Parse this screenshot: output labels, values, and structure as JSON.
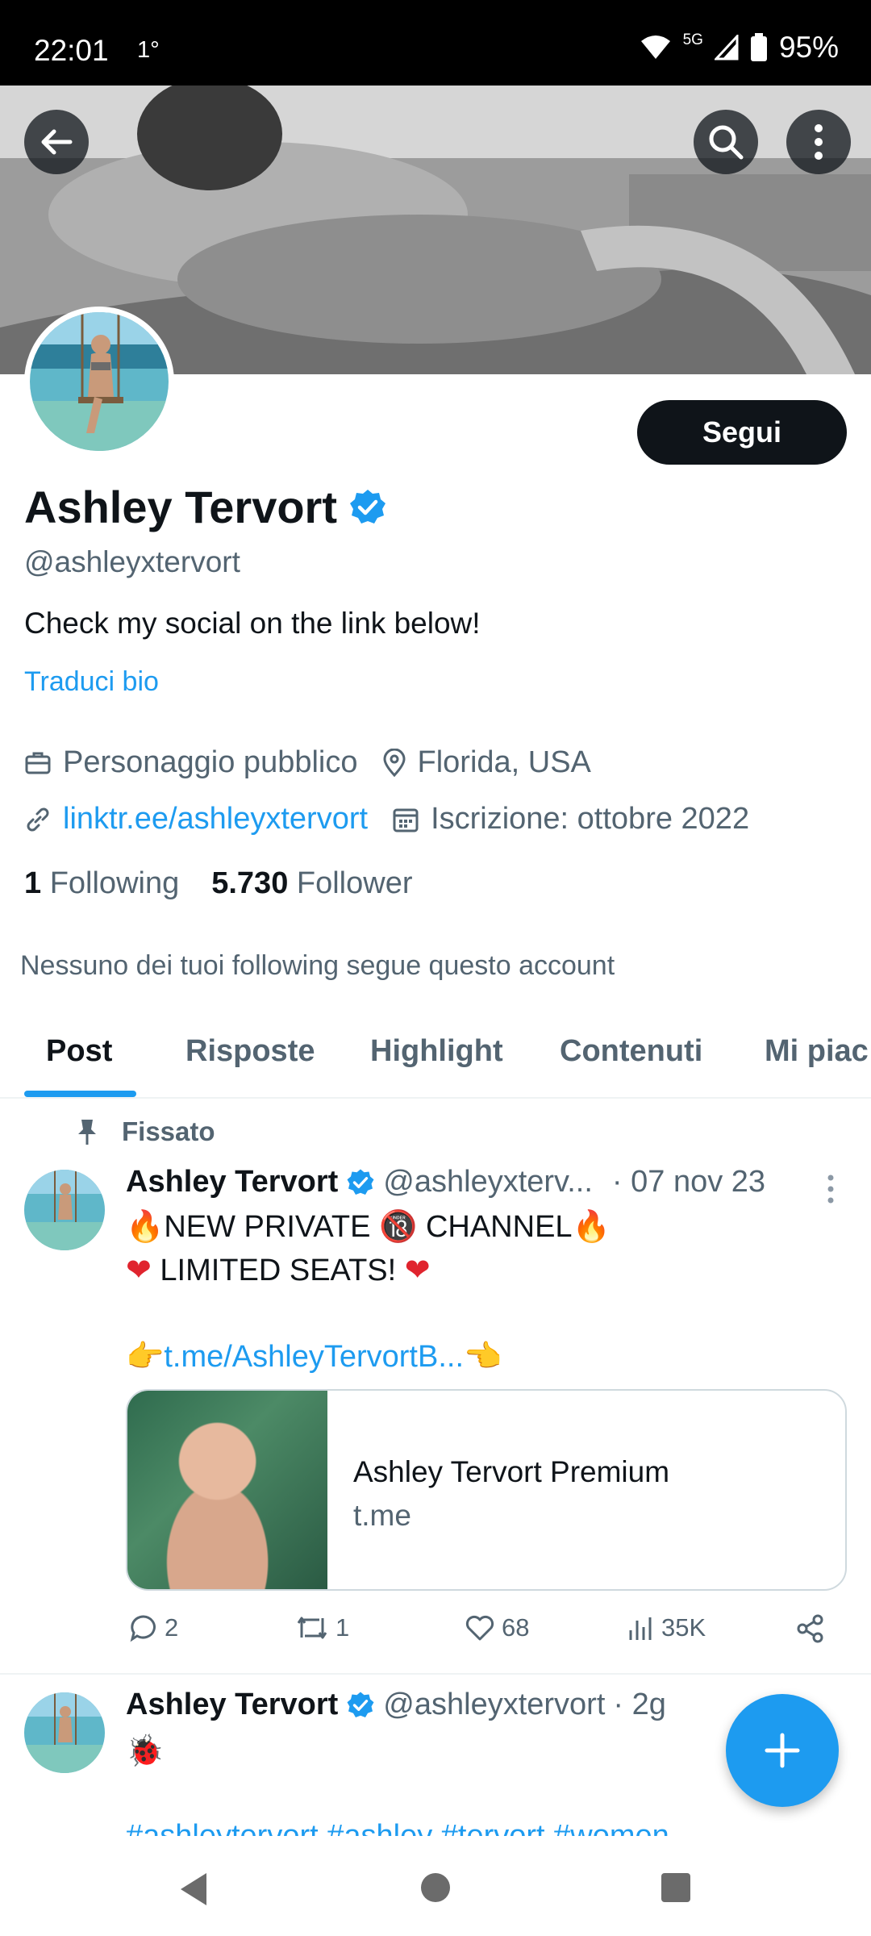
{
  "status_bar": {
    "time": "22:01",
    "temperature": "1°",
    "network": "5G",
    "battery": "95%"
  },
  "header": {
    "back_icon": "arrow-left-icon",
    "search_icon": "search-icon",
    "more_icon": "more-vertical-icon"
  },
  "profile": {
    "name": "Ashley Tervort",
    "handle": "@ashleyxtervort",
    "bio": "Check my social on the link below!",
    "translate_label": "Traduci bio",
    "follow_label": "Segui",
    "category": "Personaggio pubblico",
    "location": "Florida, USA",
    "website": "linktr.ee/ashleyxtervort",
    "joined": "Iscrizione: ottobre 2022",
    "following_count": "1",
    "following_label": "Following",
    "followers_count": "5.730",
    "followers_label": "Follower",
    "mutuals_note": "Nessuno dei tuoi following segue questo account"
  },
  "tabs": [
    "Post",
    "Risposte",
    "Highlight",
    "Contenuti",
    "Mi piac"
  ],
  "posts": [
    {
      "pinned_label": "Fissato",
      "name": "Ashley Tervort",
      "handle": "@ashleyxterv...",
      "time": "· 07 nov 23",
      "line1_a": "NEW PRIVATE",
      "line1_b": "CHANNEL",
      "line2": "LIMITED SEATS!",
      "link": "t.me/AshleyTervortB...",
      "card_title": "Ashley Tervort Premium",
      "card_domain": "t.me",
      "replies": "2",
      "reposts": "1",
      "likes": "68",
      "views": "35K"
    },
    {
      "name": "Ashley Tervort",
      "handle": "@ashleyxtervort",
      "time": "· 2g",
      "hashtags": "#ashleytervort #ashley #tervort #women"
    }
  ],
  "colors": {
    "accent": "#1d9bf0",
    "text": "#0f1419",
    "muted": "#536471"
  }
}
